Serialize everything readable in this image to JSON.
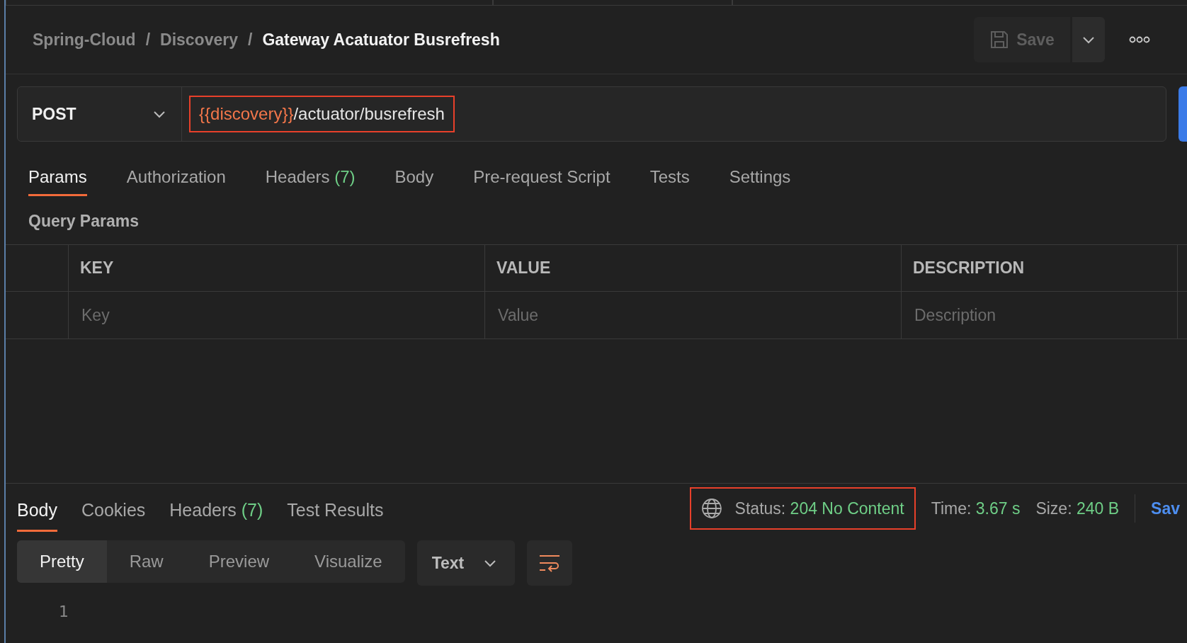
{
  "breadcrumb": [
    {
      "label": "Spring-Cloud",
      "current": false
    },
    {
      "label": "Discovery",
      "current": false
    },
    {
      "label": "Gateway Acatuator Busrefresh",
      "current": true
    }
  ],
  "breadcrumb_separator": "/",
  "save_button": {
    "label": "Save",
    "disabled": true
  },
  "request": {
    "method": "POST",
    "url_variable": "{{discovery}}",
    "url_path": "/actuator/busrefresh",
    "highlighted": true
  },
  "request_tabs": [
    {
      "label": "Params",
      "selected": true
    },
    {
      "label": "Authorization",
      "selected": false
    },
    {
      "label": "Headers",
      "count": "(7)",
      "selected": false
    },
    {
      "label": "Body",
      "selected": false
    },
    {
      "label": "Pre-request Script",
      "selected": false
    },
    {
      "label": "Tests",
      "selected": false
    },
    {
      "label": "Settings",
      "selected": false
    }
  ],
  "query_params": {
    "title": "Query Params",
    "columns": [
      "KEY",
      "VALUE",
      "DESCRIPTION"
    ],
    "placeholders": [
      "Key",
      "Value",
      "Description"
    ]
  },
  "response_tabs": [
    {
      "label": "Body",
      "selected": true
    },
    {
      "label": "Cookies",
      "selected": false
    },
    {
      "label": "Headers",
      "count": "(7)",
      "selected": false
    },
    {
      "label": "Test Results",
      "selected": false
    }
  ],
  "response_status": {
    "label": "Status:",
    "value": "204 No Content",
    "highlighted": true
  },
  "response_time": {
    "label": "Time:",
    "value": "3.67 s"
  },
  "response_size": {
    "label": "Size:",
    "value": "240 B"
  },
  "save_response_link": "Sav",
  "format_modes": [
    {
      "label": "Pretty",
      "selected": true
    },
    {
      "label": "Raw",
      "selected": false
    },
    {
      "label": "Preview",
      "selected": false
    },
    {
      "label": "Visualize",
      "selected": false
    }
  ],
  "format_type": "Text",
  "line_numbers": [
    "1"
  ]
}
